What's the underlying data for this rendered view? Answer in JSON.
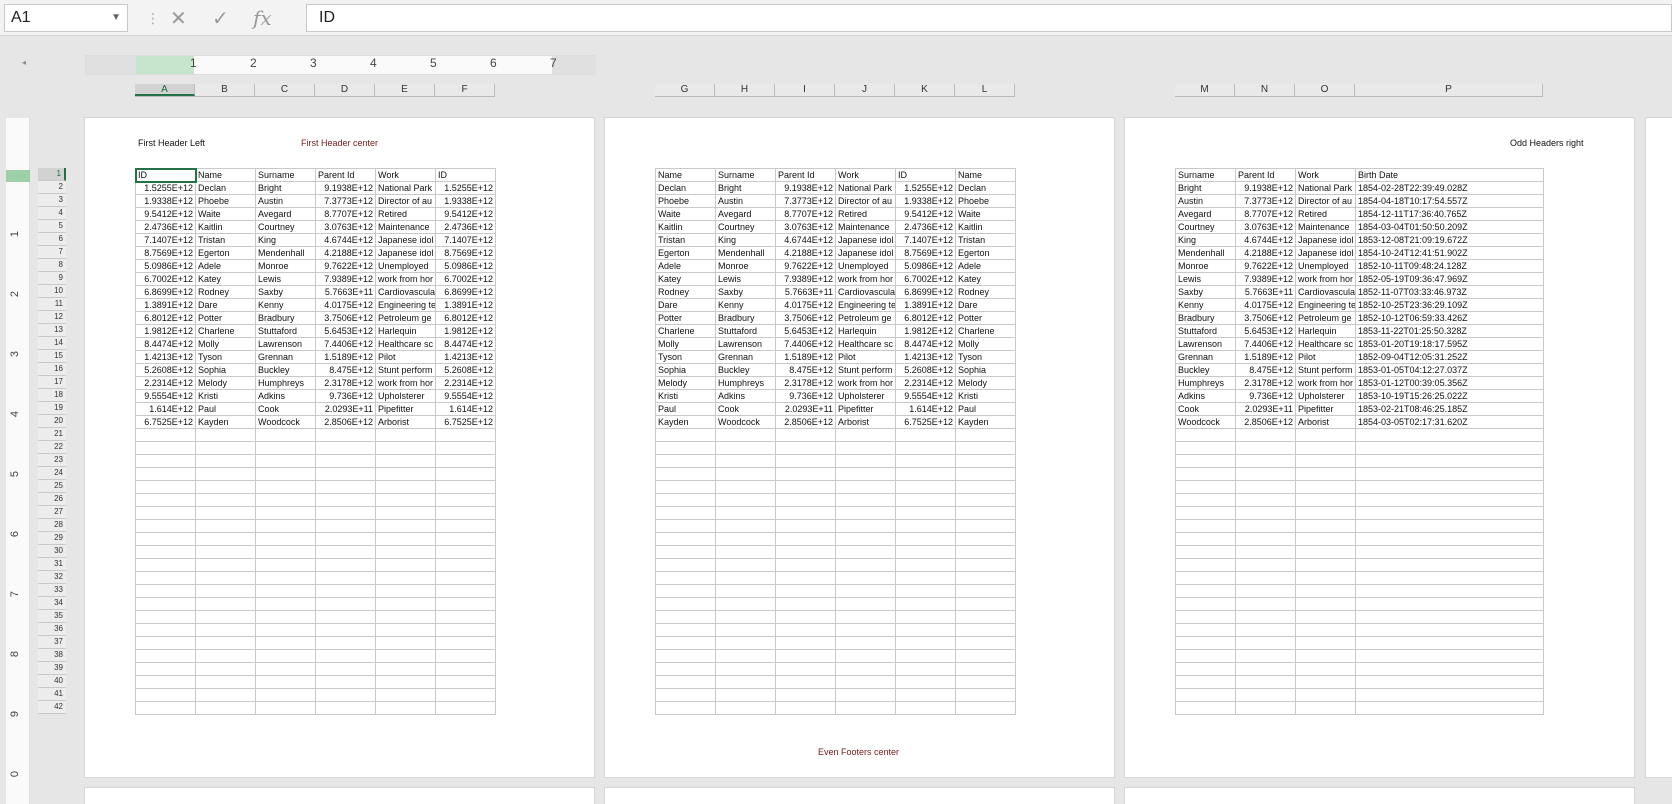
{
  "name_box": {
    "value": "A1"
  },
  "formula_bar": {
    "cancel_icon": "✕",
    "enter_icon": "✓",
    "fx_label": "fx",
    "content": "ID"
  },
  "ruler": {
    "numbers": [
      "1",
      "2",
      "3",
      "4",
      "5",
      "6",
      "7"
    ],
    "vertical_numbers": [
      "1",
      "2",
      "3",
      "4",
      "5",
      "6",
      "7",
      "8",
      "9",
      "0"
    ]
  },
  "columns": {
    "page1": [
      "A",
      "B",
      "C",
      "D",
      "E",
      "F"
    ],
    "page2": [
      "G",
      "H",
      "I",
      "J",
      "K",
      "L"
    ],
    "page3": [
      "M",
      "N",
      "O",
      "P"
    ]
  },
  "page1": {
    "header_left": "First Header Left",
    "header_center": "First Header center"
  },
  "page2": {
    "footer_center": "Even Footers center"
  },
  "page3": {
    "header_right": "Odd Headers right"
  },
  "row_numbers": [
    "1",
    "2",
    "3",
    "4",
    "5",
    "6",
    "7",
    "8",
    "9",
    "10",
    "11",
    "12",
    "13",
    "14",
    "15",
    "16",
    "17",
    "18",
    "19",
    "20",
    "21",
    "22",
    "23",
    "24",
    "25",
    "26",
    "27",
    "28",
    "29",
    "30",
    "31",
    "32",
    "33",
    "34",
    "35",
    "36",
    "37",
    "38",
    "39",
    "40",
    "41",
    "42"
  ],
  "sheet": {
    "headers_p1": [
      "ID",
      "Name",
      "Surname",
      "Parent Id",
      "Work",
      "ID"
    ],
    "headers_p2": [
      "Name",
      "Surname",
      "Parent Id",
      "Work",
      "ID",
      "Name"
    ],
    "headers_p3": [
      "Surname",
      "Parent Id",
      "Work",
      "Birth Date"
    ],
    "rows": [
      [
        "1.5255E+12",
        "Declan",
        "Bright",
        "9.1938E+12",
        "National Park",
        "1854-02-28T22:39:49.028Z"
      ],
      [
        "1.9338E+12",
        "Phoebe",
        "Austin",
        "7.3773E+12",
        "Director of au",
        "1854-04-18T10:17:54.557Z"
      ],
      [
        "9.5412E+12",
        "Waite",
        "Avegard",
        "8.7707E+12",
        "Retired",
        "1854-12-11T17:36:40.765Z"
      ],
      [
        "2.4736E+12",
        "Kaitlin",
        "Courtney",
        "3.0763E+12",
        "Maintenance",
        "1854-03-04T01:50:50.209Z"
      ],
      [
        "7.1407E+12",
        "Tristan",
        "King",
        "4.6744E+12",
        "Japanese idol",
        "1853-12-08T21:09:19.672Z"
      ],
      [
        "8.7569E+12",
        "Egerton",
        "Mendenhall",
        "4.2188E+12",
        "Japanese idol",
        "1854-10-24T12:41:51.902Z"
      ],
      [
        "5.0986E+12",
        "Adele",
        "Monroe",
        "9.7622E+12",
        "Unemployed",
        "1852-10-11T09:48:24.128Z"
      ],
      [
        "6.7002E+12",
        "Katey",
        "Lewis",
        "7.9389E+12",
        "work from hor",
        "1852-05-19T09:36:47.969Z"
      ],
      [
        "6.8699E+12",
        "Rodney",
        "Saxby",
        "5.7663E+11",
        "Cardiovascula",
        "1852-11-07T03:33:46.973Z"
      ],
      [
        "1.3891E+12",
        "Dare",
        "Kenny",
        "4.0175E+12",
        "Engineering te",
        "1852-10-25T23:36:29.109Z"
      ],
      [
        "6.8012E+12",
        "Potter",
        "Bradbury",
        "3.7506E+12",
        "Petroleum ge",
        "1852-10-12T06:59:33.426Z"
      ],
      [
        "1.9812E+12",
        "Charlene",
        "Stuttaford",
        "5.6453E+12",
        "Harlequin",
        "1853-11-22T01:25:50.328Z"
      ],
      [
        "8.4474E+12",
        "Molly",
        "Lawrenson",
        "7.4406E+12",
        "Healthcare sc",
        "1853-01-20T19:18:17.595Z"
      ],
      [
        "1.4213E+12",
        "Tyson",
        "Grennan",
        "1.5189E+12",
        "Pilot",
        "1852-09-04T12:05:31.252Z"
      ],
      [
        "5.2608E+12",
        "Sophia",
        "Buckley",
        "8.475E+12",
        "Stunt perform",
        "1853-01-05T04:12:27.037Z"
      ],
      [
        "2.2314E+12",
        "Melody",
        "Humphreys",
        "2.3178E+12",
        "work from hor",
        "1853-01-12T00:39:05.356Z"
      ],
      [
        "9.5554E+12",
        "Kristi",
        "Adkins",
        "9.736E+12",
        "Upholsterer",
        "1853-10-19T15:26:25.022Z"
      ],
      [
        "1.614E+12",
        "Paul",
        "Cook",
        "2.0293E+11",
        "Pipefitter",
        "1853-02-21T08:46:25.185Z"
      ],
      [
        "6.7525E+12",
        "Kayden",
        "Woodcock",
        "2.8506E+12",
        "Arborist",
        "1854-03-05T02:17:31.620Z"
      ]
    ]
  }
}
